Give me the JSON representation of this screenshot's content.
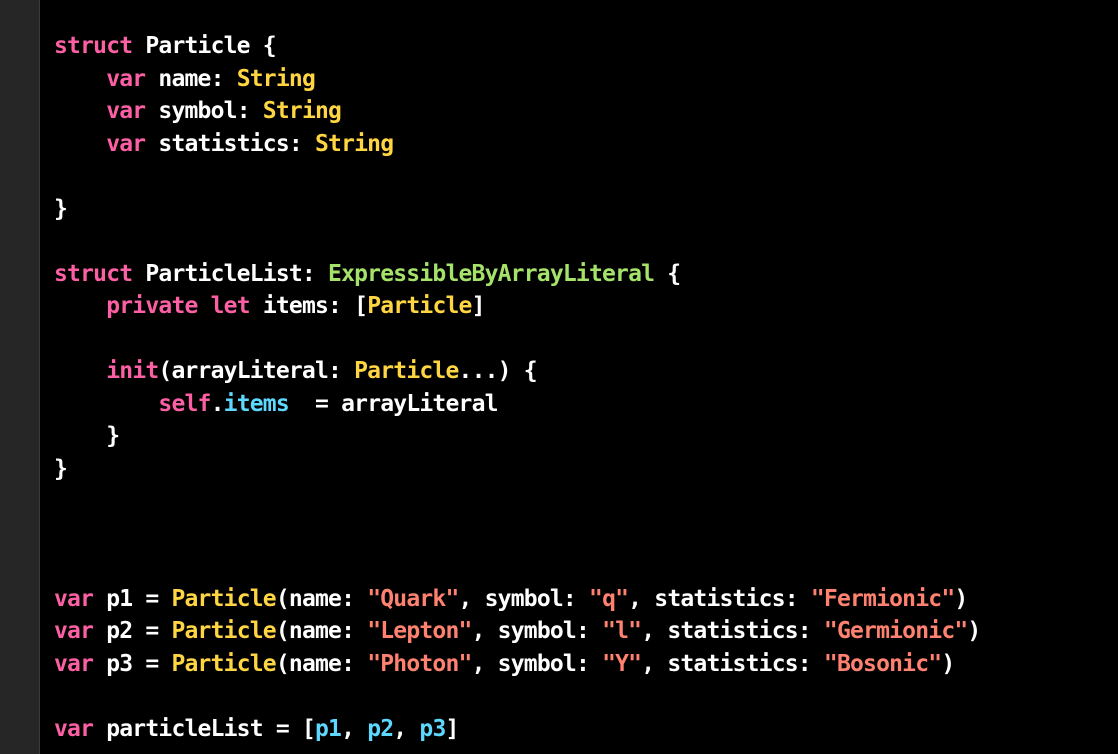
{
  "editor": {
    "lines": [
      [
        {
          "t": "kw",
          "s": "struct"
        },
        {
          "t": "plain",
          "s": " Particle {"
        }
      ],
      [
        {
          "t": "plain",
          "s": "    "
        },
        {
          "t": "kw",
          "s": "var"
        },
        {
          "t": "plain",
          "s": " name: "
        },
        {
          "t": "type",
          "s": "String"
        }
      ],
      [
        {
          "t": "plain",
          "s": "    "
        },
        {
          "t": "kw",
          "s": "var"
        },
        {
          "t": "plain",
          "s": " symbol: "
        },
        {
          "t": "type",
          "s": "String"
        }
      ],
      [
        {
          "t": "plain",
          "s": "    "
        },
        {
          "t": "kw",
          "s": "var"
        },
        {
          "t": "plain",
          "s": " statistics: "
        },
        {
          "t": "type",
          "s": "String"
        }
      ],
      [],
      [
        {
          "t": "plain",
          "s": "}"
        }
      ],
      [],
      [
        {
          "t": "kw",
          "s": "struct"
        },
        {
          "t": "plain",
          "s": " ParticleList: "
        },
        {
          "t": "proto",
          "s": "ExpressibleByArrayLiteral"
        },
        {
          "t": "plain",
          "s": " {"
        }
      ],
      [
        {
          "t": "plain",
          "s": "    "
        },
        {
          "t": "kw",
          "s": "private"
        },
        {
          "t": "plain",
          "s": " "
        },
        {
          "t": "kw",
          "s": "let"
        },
        {
          "t": "plain",
          "s": " items: ["
        },
        {
          "t": "type",
          "s": "Particle"
        },
        {
          "t": "plain",
          "s": "]"
        }
      ],
      [],
      [
        {
          "t": "plain",
          "s": "    "
        },
        {
          "t": "kw",
          "s": "init"
        },
        {
          "t": "plain",
          "s": "(arrayLiteral: "
        },
        {
          "t": "type",
          "s": "Particle"
        },
        {
          "t": "plain",
          "s": "...) {"
        }
      ],
      [
        {
          "t": "plain",
          "s": "        "
        },
        {
          "t": "kw",
          "s": "self"
        },
        {
          "t": "plain",
          "s": "."
        },
        {
          "t": "prop",
          "s": "items"
        },
        {
          "t": "plain",
          "s": "  = arrayLiteral"
        }
      ],
      [
        {
          "t": "plain",
          "s": "    }"
        }
      ],
      [
        {
          "t": "plain",
          "s": "}"
        }
      ],
      [],
      [],
      [],
      [
        {
          "t": "kw",
          "s": "var"
        },
        {
          "t": "plain",
          "s": " p1 = "
        },
        {
          "t": "type",
          "s": "Particle"
        },
        {
          "t": "plain",
          "s": "(name: "
        },
        {
          "t": "str",
          "s": "\"Quark\""
        },
        {
          "t": "plain",
          "s": ", symbol: "
        },
        {
          "t": "str",
          "s": "\"q\""
        },
        {
          "t": "plain",
          "s": ", statistics: "
        },
        {
          "t": "str",
          "s": "\"Fermionic\""
        },
        {
          "t": "plain",
          "s": ")"
        }
      ],
      [
        {
          "t": "kw",
          "s": "var"
        },
        {
          "t": "plain",
          "s": " p2 = "
        },
        {
          "t": "type",
          "s": "Particle"
        },
        {
          "t": "plain",
          "s": "(name: "
        },
        {
          "t": "str",
          "s": "\"Lepton\""
        },
        {
          "t": "plain",
          "s": ", symbol: "
        },
        {
          "t": "str",
          "s": "\"l\""
        },
        {
          "t": "plain",
          "s": ", statistics: "
        },
        {
          "t": "str",
          "s": "\"Germionic\""
        },
        {
          "t": "plain",
          "s": ")"
        }
      ],
      [
        {
          "t": "kw",
          "s": "var"
        },
        {
          "t": "plain",
          "s": " p3 = "
        },
        {
          "t": "type",
          "s": "Particle"
        },
        {
          "t": "plain",
          "s": "(name: "
        },
        {
          "t": "str",
          "s": "\"Photon\""
        },
        {
          "t": "plain",
          "s": ", symbol: "
        },
        {
          "t": "str",
          "s": "\"Y\""
        },
        {
          "t": "plain",
          "s": ", statistics: "
        },
        {
          "t": "str",
          "s": "\"Bosonic\""
        },
        {
          "t": "plain",
          "s": ")"
        }
      ],
      [],
      [
        {
          "t": "kw",
          "s": "var"
        },
        {
          "t": "plain",
          "s": " particleList = ["
        },
        {
          "t": "prop",
          "s": "p1"
        },
        {
          "t": "plain",
          "s": ", "
        },
        {
          "t": "prop",
          "s": "p2"
        },
        {
          "t": "plain",
          "s": ", "
        },
        {
          "t": "prop",
          "s": "p3"
        },
        {
          "t": "plain",
          "s": "]"
        }
      ]
    ]
  },
  "colors": {
    "background": "#000000",
    "gutter": "#262626",
    "keyword": "#fc5fa3",
    "type": "#ffd642",
    "protocol": "#a5e26a",
    "string": "#ff8170",
    "property": "#5dd8ff",
    "plain": "#ffffff"
  }
}
